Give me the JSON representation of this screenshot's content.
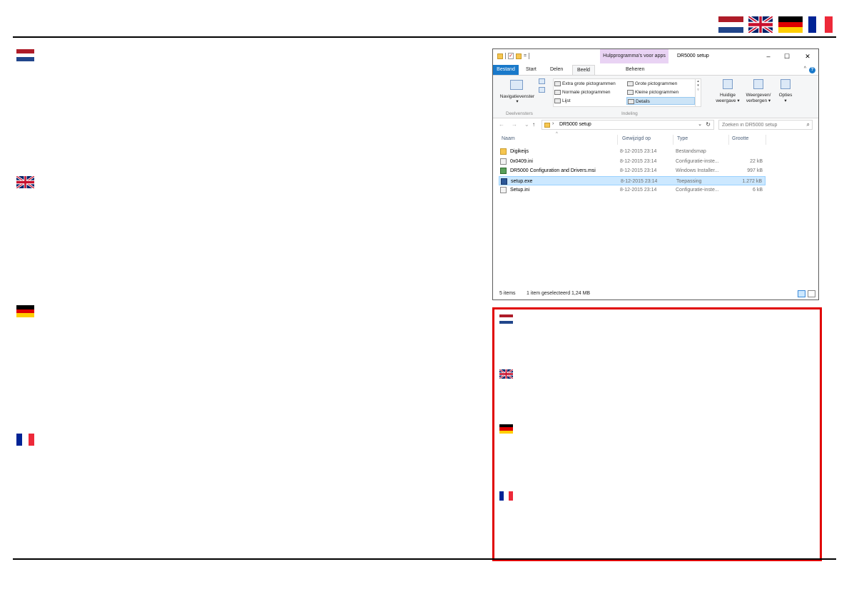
{
  "header": {
    "flags": [
      "flag-nl",
      "flag-uk",
      "flag-de",
      "flag-fr"
    ]
  },
  "left_sections": [
    "flag-nl",
    "flag-uk",
    "flag-de",
    "flag-fr"
  ],
  "explorer": {
    "quick_access": {
      "dropdown": "="
    },
    "tool_tab": "Hulpprogramma's voor apps",
    "title": "DR5000 setup",
    "controls": {
      "minimize": "–",
      "maximize": "☐",
      "close": "✕"
    },
    "ribbon_tabs": [
      "Bestand",
      "Start",
      "Delen",
      "Beeld",
      "Beheren"
    ],
    "help": "?",
    "ribbon": {
      "nav_pane_label": "Navigatievenster",
      "nav_pane_arrow": "▾",
      "group_panes": "Deelvensters",
      "layout": {
        "extra_large": "Extra grote pictogrammen",
        "large": "Grote pictogrammen",
        "medium": "Normale pictogrammen",
        "small": "Kleine pictogrammen",
        "list": "Lijst",
        "details": "Details"
      },
      "group_layout": "Indeling",
      "current_view": "Huidige\nweergave ▾",
      "show_hide": "Weergeven/\nverbergen ▾",
      "options": "Opties\n▾"
    },
    "address": {
      "path": "DR5000 setup",
      "search_placeholder": "Zoeken in DR5000 setup"
    },
    "columns": {
      "name": "Naam",
      "date": "Gewijzigd op",
      "type": "Type",
      "size": "Grootte"
    },
    "files": [
      {
        "name": "Digikeijs",
        "date": "8-12-2015 23:14",
        "type": "Bestandsmap",
        "size": "",
        "icon": "folder-icon"
      },
      {
        "name": "0x0409.ini",
        "date": "8-12-2015 23:14",
        "type": "Configuratie-inste...",
        "size": "22 kB",
        "icon": "ini-file-icon"
      },
      {
        "name": "DR5000 Configuration and Drivers.msi",
        "date": "8-12-2015 23:14",
        "type": "Windows Installer...",
        "size": "997 kB",
        "icon": "msi-file-icon"
      },
      {
        "name": "setup.exe",
        "date": "8-12-2015 23:14",
        "type": "Toepassing",
        "size": "1.272 kB",
        "icon": "exe-file-icon"
      },
      {
        "name": "Setup.ini",
        "date": "8-12-2015 23:14",
        "type": "Configuratie-inste...",
        "size": "6 kB",
        "icon": "ini-file-icon"
      }
    ],
    "selected_index": 3,
    "status": {
      "count": "5 items",
      "selection": "1 item geselecteerd  1,24 MB"
    }
  },
  "colors": {
    "frame": "#e00000",
    "file_tab": "#1979ca",
    "tool_tab": "#e9d3f4",
    "selection": "#cce8ff"
  },
  "red_box_sections": [
    "flag-nl",
    "flag-uk",
    "flag-de",
    "flag-fr"
  ]
}
